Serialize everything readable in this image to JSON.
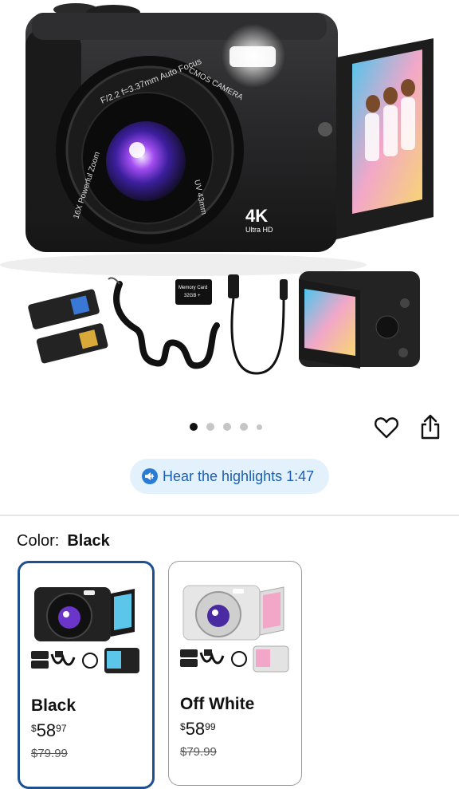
{
  "hero": {
    "lens_text_1": "F/2.2 f=3.37mm Auto Focus",
    "lens_text_2": "16X Powerful Zoom",
    "lens_text_3": "UV 43mm",
    "brand_text": "CMOS CAMERA",
    "badge_main": "4K",
    "badge_sub": "Ultra HD",
    "memory_card_line1": "Memory Card",
    "memory_card_line2": "32GB +",
    "carousel_total": 5,
    "carousel_active": 0
  },
  "actions": {
    "favorite_icon": "heart-icon",
    "share_icon": "share-icon"
  },
  "audio_pill": {
    "label": "Hear the highlights 1:47",
    "icon": "speaker-icon"
  },
  "color_selector": {
    "label": "Color:",
    "selected": "Black",
    "options": [
      {
        "name": "Black",
        "currency": "$",
        "whole": "58",
        "cents": "97",
        "list_price": "$79.99"
      },
      {
        "name": "Off White",
        "currency": "$",
        "whole": "58",
        "cents": "99",
        "list_price": "$79.99"
      }
    ]
  },
  "colors": {
    "accent": "#1d4f91",
    "pill_bg": "#e3f1fc",
    "pill_text": "#1c5fb3"
  }
}
